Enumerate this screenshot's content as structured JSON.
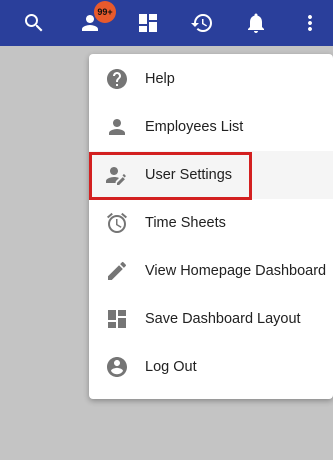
{
  "toolbar": {
    "icons": [
      "search-icon",
      "person-icon",
      "dashboard-icon",
      "history-icon",
      "notifications-icon",
      "more-vert-icon"
    ],
    "badge": "99+",
    "badge_color": "#e85a2c",
    "background_color": "#2a3f9b"
  },
  "menu": {
    "items": [
      {
        "label": "Help",
        "icon": "help-icon"
      },
      {
        "label": "Employees List",
        "icon": "person-icon"
      },
      {
        "label": "User Settings",
        "icon": "user-edit-icon",
        "highlighted": true
      },
      {
        "label": "Time Sheets",
        "icon": "alarm-icon"
      },
      {
        "label": "View Homepage Dashboard",
        "icon": "edit-icon"
      },
      {
        "label": "Save Dashboard Layout",
        "icon": "dashboard-icon"
      },
      {
        "label": "Log Out",
        "icon": "account-circle-icon"
      }
    ],
    "highlight_color": "#d32020"
  },
  "background_color": "#c4c4c4"
}
